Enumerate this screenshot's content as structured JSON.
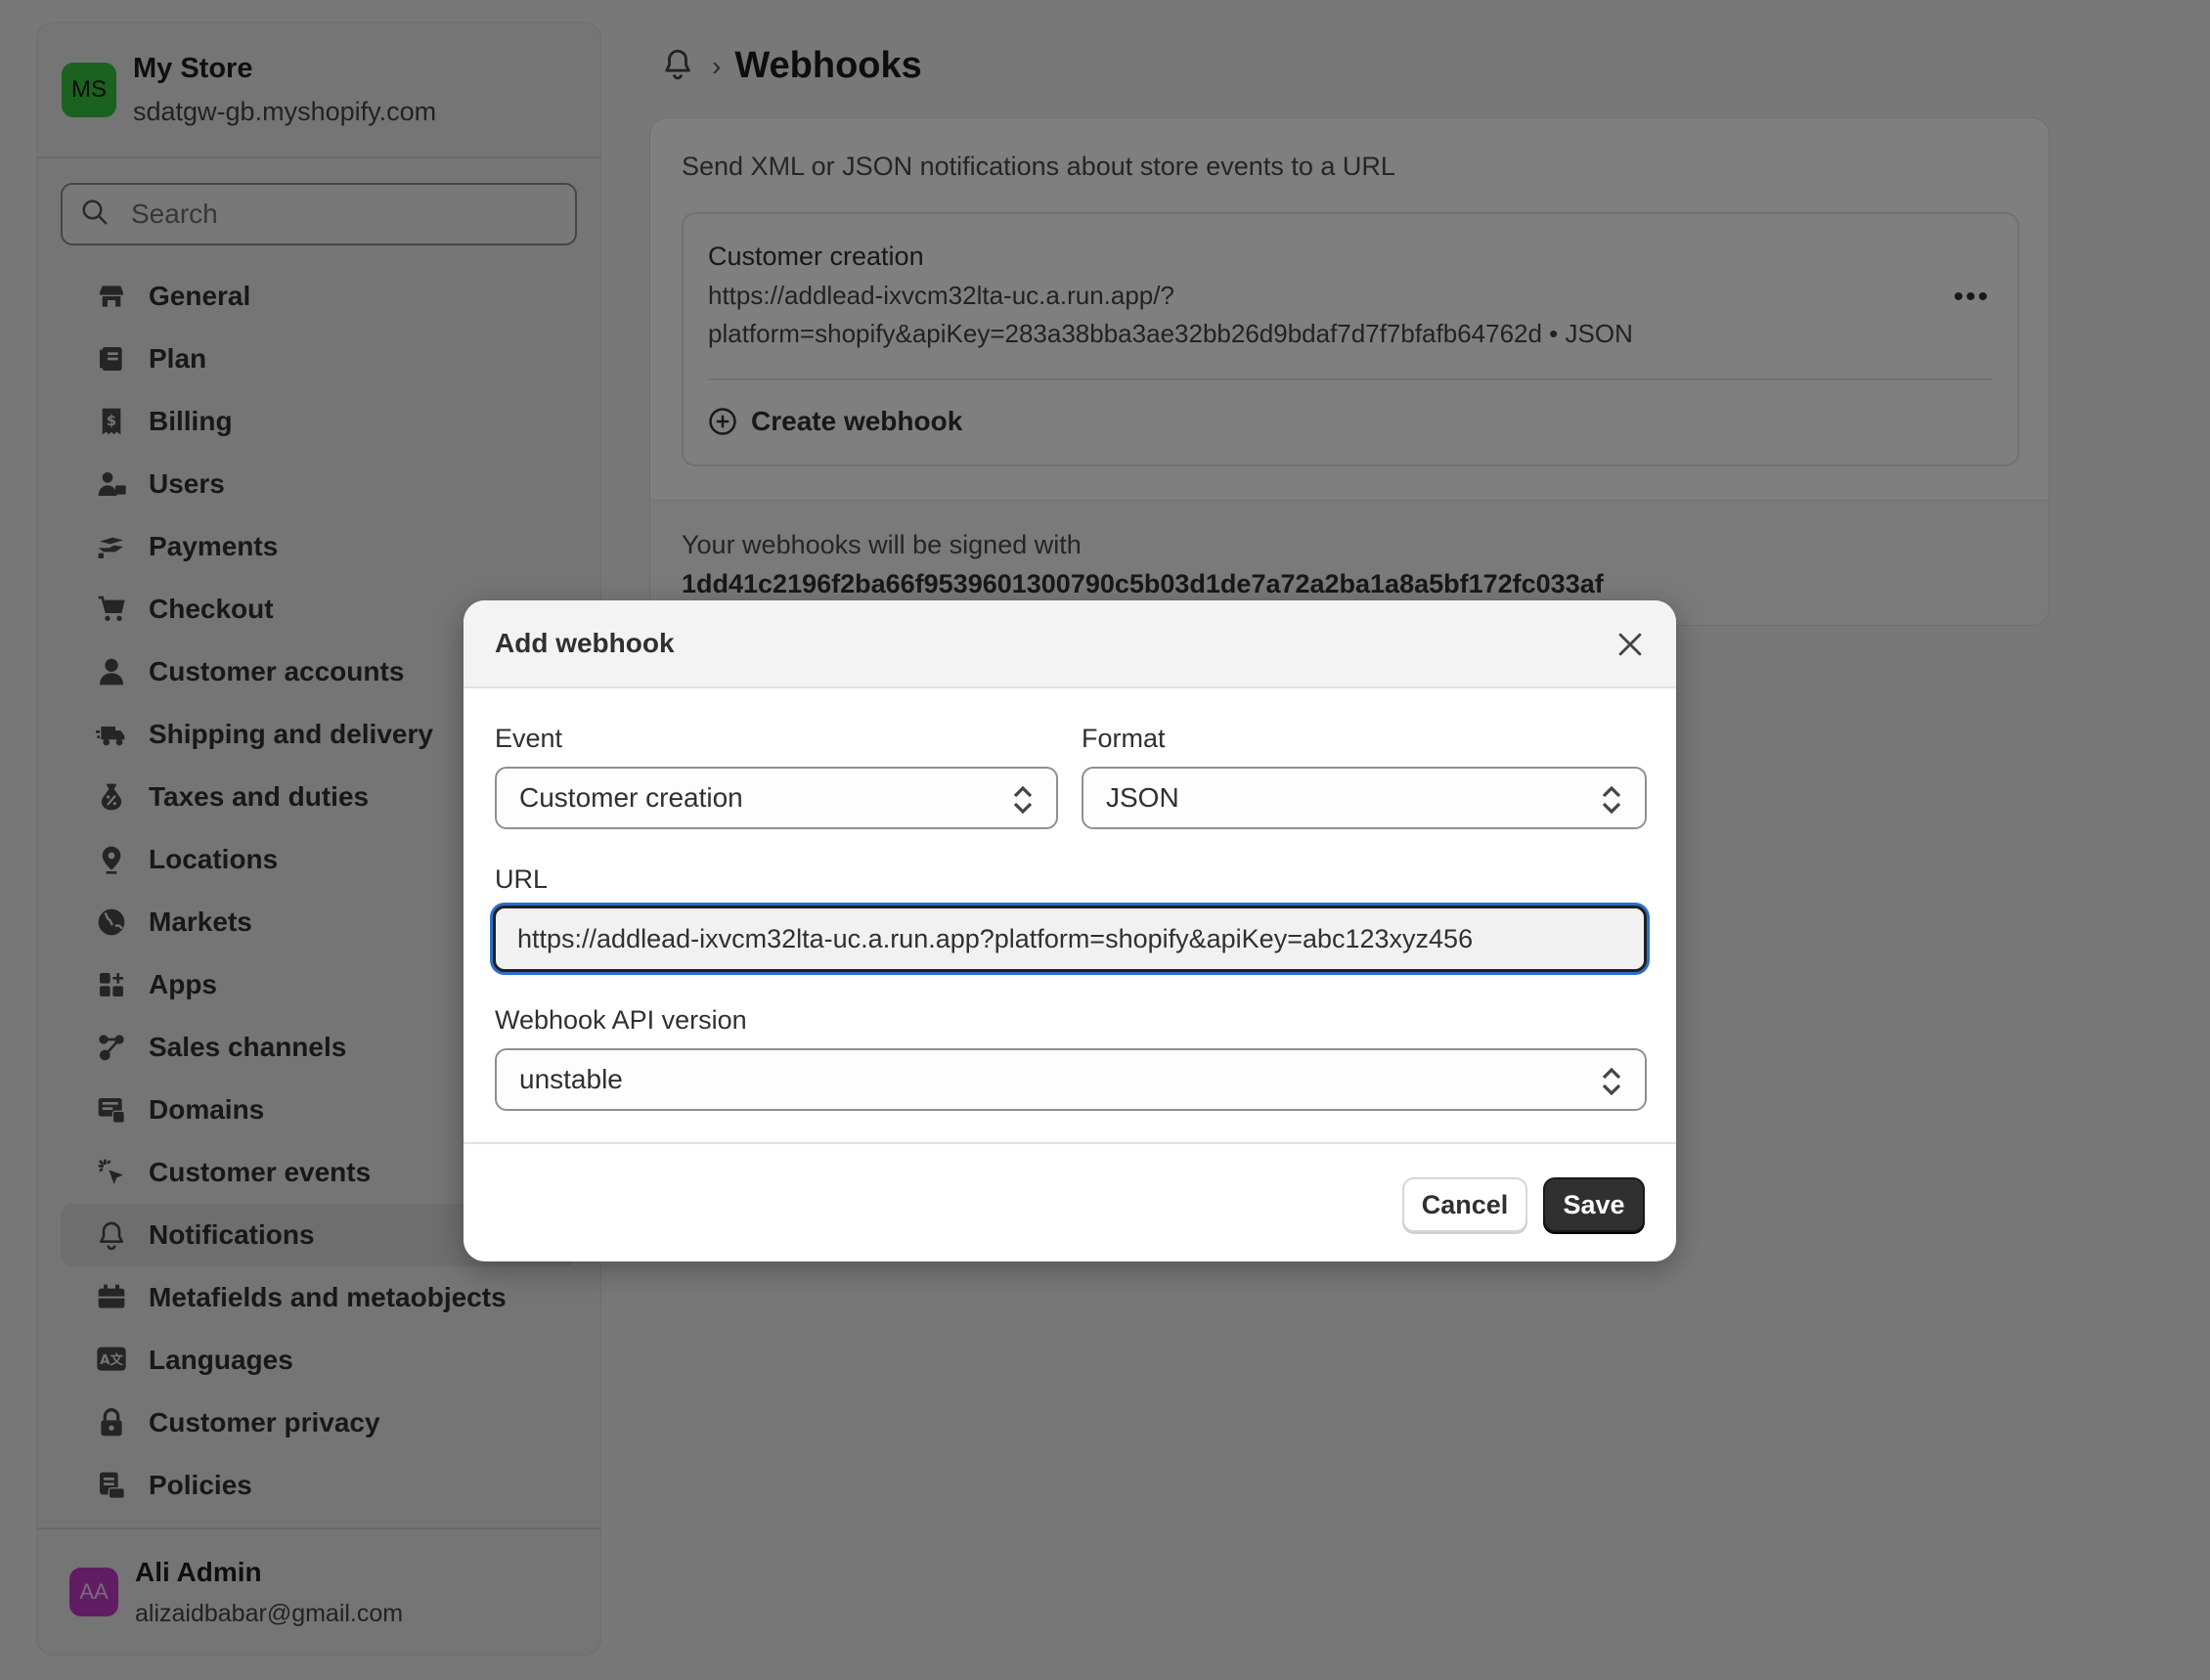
{
  "store": {
    "initials": "MS",
    "name": "My Store",
    "domain": "sdatgw-gb.myshopify.com"
  },
  "search": {
    "placeholder": "Search"
  },
  "sidebar": {
    "items": [
      {
        "label": "General",
        "icon": "store-icon"
      },
      {
        "label": "Plan",
        "icon": "plan-icon"
      },
      {
        "label": "Billing",
        "icon": "billing-icon"
      },
      {
        "label": "Users",
        "icon": "users-icon"
      },
      {
        "label": "Payments",
        "icon": "payments-icon"
      },
      {
        "label": "Checkout",
        "icon": "cart-icon"
      },
      {
        "label": "Customer accounts",
        "icon": "person-icon"
      },
      {
        "label": "Shipping and delivery",
        "icon": "truck-icon"
      },
      {
        "label": "Taxes and duties",
        "icon": "tax-icon"
      },
      {
        "label": "Locations",
        "icon": "location-icon"
      },
      {
        "label": "Markets",
        "icon": "globe-icon"
      },
      {
        "label": "Apps",
        "icon": "apps-icon"
      },
      {
        "label": "Sales channels",
        "icon": "sales-channels-icon"
      },
      {
        "label": "Domains",
        "icon": "domains-icon"
      },
      {
        "label": "Customer events",
        "icon": "cursor-click-icon"
      },
      {
        "label": "Notifications",
        "icon": "bell-icon",
        "active": true
      },
      {
        "label": "Metafields and metaobjects",
        "icon": "metafields-icon"
      },
      {
        "label": "Languages",
        "icon": "languages-icon"
      },
      {
        "label": "Customer privacy",
        "icon": "lock-icon"
      },
      {
        "label": "Policies",
        "icon": "policies-icon"
      }
    ]
  },
  "user": {
    "initials": "AA",
    "name": "Ali Admin",
    "email": "alizaidbabar@gmail.com"
  },
  "breadcrumb": {
    "separator": "›",
    "title": "Webhooks"
  },
  "webhooks": {
    "description": "Send XML or JSON notifications about store events to a URL",
    "item": {
      "event": "Customer creation",
      "url_line1": "https://addlead-ixvcm32lta-uc.a.run.app/?",
      "url_line2": "platform=shopify&apiKey=283a38bba3ae32bb26d9bdaf7d7f7bfafb64762d • JSON",
      "more": "•••"
    },
    "create_label": "Create webhook",
    "signed_label": "Your webhooks will be signed with",
    "signature": "1dd41c2196f2ba66f9539601300790c5b03d1de7a72a2ba1a8a5bf172fc033af"
  },
  "modal": {
    "title": "Add webhook",
    "event_label": "Event",
    "event_value": "Customer creation",
    "format_label": "Format",
    "format_value": "JSON",
    "url_label": "URL",
    "url_value": "https://addlead-ixvcm32lta-uc.a.run.app?platform=shopify&apiKey=abc123xyz456",
    "version_label": "Webhook API version",
    "version_value": "unstable",
    "cancel_label": "Cancel",
    "save_label": "Save"
  }
}
